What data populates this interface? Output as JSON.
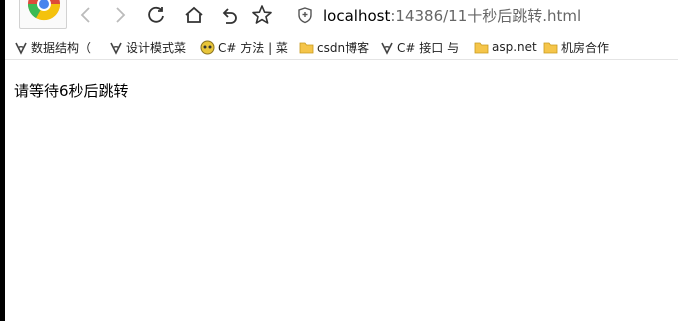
{
  "browser": {
    "address_bar": {
      "host": "localhost",
      "path": ":14386/11十秒后跳转.html"
    },
    "nav_icons": [
      "back-icon",
      "forward-icon",
      "reload-icon",
      "home-icon",
      "undo-icon",
      "star-icon"
    ],
    "bookmarks": [
      {
        "label": "数据结构（",
        "icon": "csdn-logo-icon"
      },
      {
        "label": "设计模式菜",
        "icon": "csdn-logo-icon"
      },
      {
        "label": "C# 方法 | 菜",
        "icon": "runoob-icon"
      },
      {
        "label": "csdn博客",
        "icon": "folder-icon"
      },
      {
        "label": "C# 接口 与",
        "icon": "csdn-logo-icon"
      },
      {
        "label": "asp.net",
        "icon": "folder-icon"
      },
      {
        "label": "机房合作",
        "icon": "folder-icon"
      }
    ]
  },
  "page": {
    "message": "请等待6秒后跳转"
  },
  "colors": {
    "folder": "#f5c54a",
    "icon_stroke": "#555555",
    "url_path": "#666666"
  }
}
